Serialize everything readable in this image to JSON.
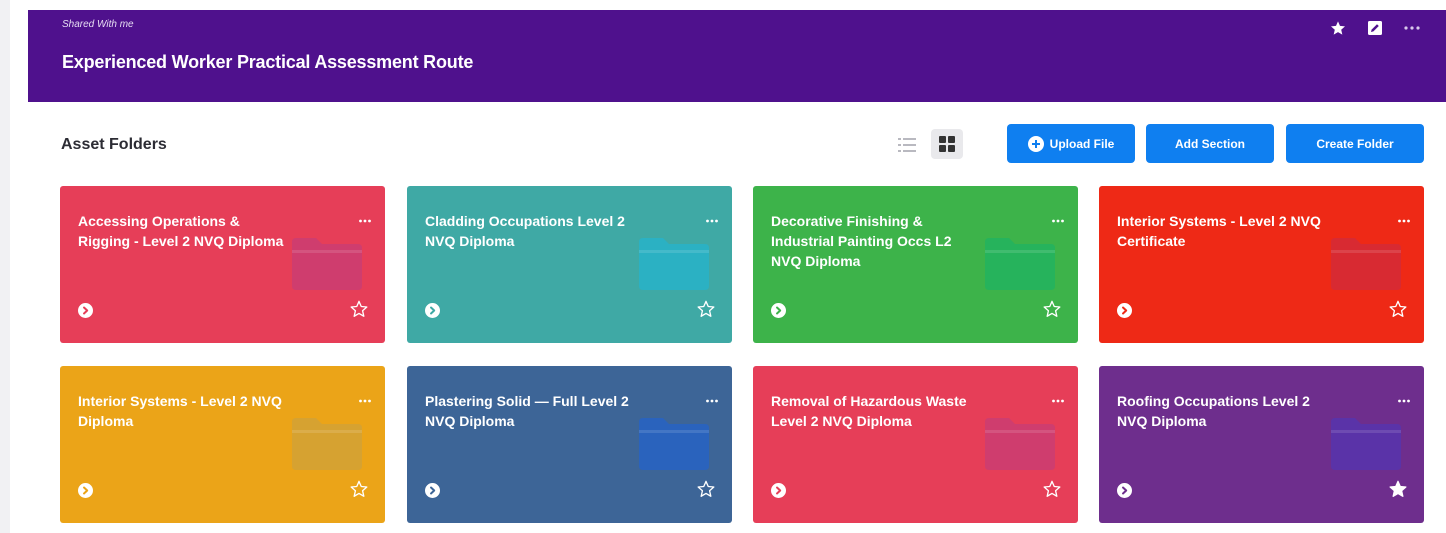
{
  "header": {
    "shared_label": "Shared With me",
    "title": "Experienced Worker Practical Assessment Route"
  },
  "toolbar": {
    "section_title": "Asset Folders",
    "upload_label": "Upload File",
    "add_section_label": "Add Section",
    "create_folder_label": "Create Folder"
  },
  "colors": {
    "banner": "#4f118d",
    "primary_button": "#0f7ff0"
  },
  "folders": [
    {
      "name": "Accessing Operations & Rigging - Level 2 NVQ Diploma",
      "color": "#e63e58",
      "folder_color": "#cf3d6e",
      "favorite": false
    },
    {
      "name": "Cladding Occupations Level 2 NVQ Diploma",
      "color": "#3fa9a5",
      "folder_color": "#2bb1c3",
      "favorite": false
    },
    {
      "name": "Decorative Finishing & Industrial Painting Occs L2 NVQ Diploma",
      "color": "#3db34a",
      "folder_color": "#26b35c",
      "favorite": false
    },
    {
      "name": "Interior Systems - Level 2 NVQ Certificate",
      "color": "#ee2916",
      "folder_color": "#d82a32",
      "favorite": false
    },
    {
      "name": "Interior Systems - Level 2 NVQ Diploma",
      "color": "#eba418",
      "folder_color": "#d6a231",
      "favorite": false
    },
    {
      "name": "Plastering Solid — Full Level 2 NVQ Diploma",
      "color": "#3d6597",
      "folder_color": "#2a63bd",
      "favorite": false
    },
    {
      "name": "Removal of Hazardous Waste Level 2 NVQ Diploma",
      "color": "#e63e58",
      "folder_color": "#cf3d6e",
      "favorite": false
    },
    {
      "name": "Roofing Occupations Level 2 NVQ Diploma",
      "color": "#6e2e8d",
      "folder_color": "#5a33a8",
      "favorite": true
    }
  ]
}
